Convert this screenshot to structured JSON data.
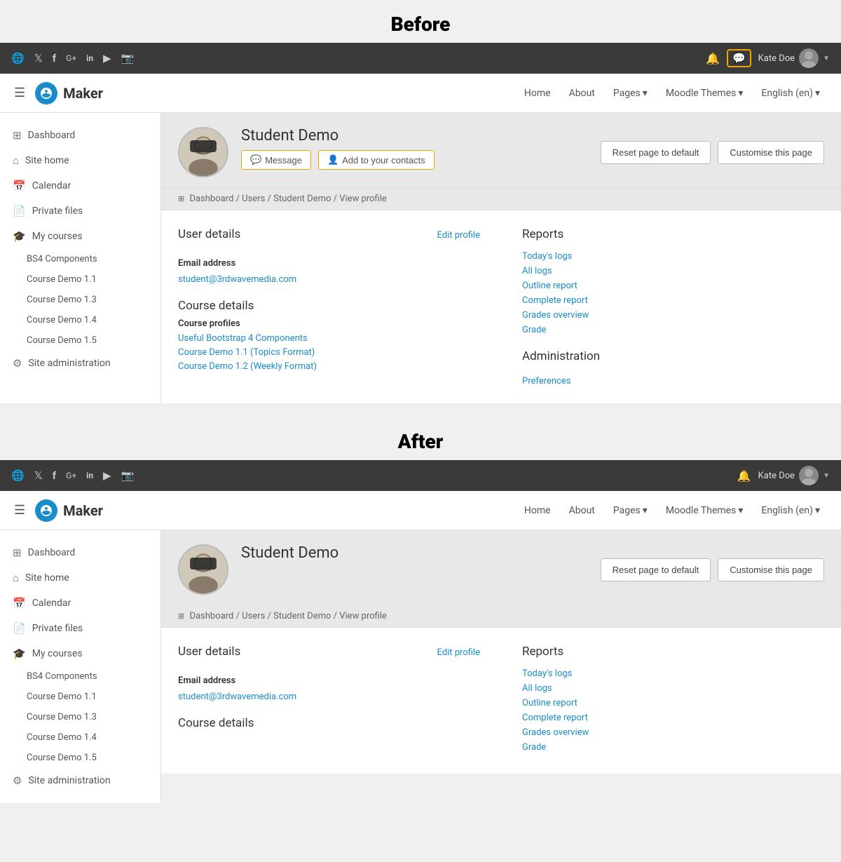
{
  "before_label": "Before",
  "after_label": "After",
  "topbar": {
    "icons": [
      "🌐",
      "🐦",
      "f",
      "G+",
      "in",
      "▶",
      "📷"
    ],
    "bell": "🔔",
    "username": "Kate Doe",
    "message_icon": "💬",
    "caret": "▼"
  },
  "navbar": {
    "logo_text": "Maker",
    "home": "Home",
    "about": "About",
    "pages": "Pages",
    "moodle_themes": "Moodle Themes",
    "english": "English (en)"
  },
  "sidebar": {
    "dashboard": "Dashboard",
    "site_home": "Site home",
    "calendar": "Calendar",
    "private_files": "Private files",
    "my_courses": "My courses",
    "courses": [
      "BS4 Components",
      "Course Demo 1.1",
      "Course Demo 1.3",
      "Course Demo 1.4",
      "Course Demo 1.5"
    ],
    "site_admin": "Site administration"
  },
  "profile": {
    "name": "Student Demo",
    "message_btn": "Message",
    "contacts_btn": "Add to your contacts",
    "reset_btn": "Reset page to default",
    "customise_btn": "Customise this page"
  },
  "breadcrumb": {
    "dashboard": "Dashboard",
    "users": "Users",
    "student_demo": "Student Demo",
    "view_profile": "View profile"
  },
  "user_details": {
    "title": "User details",
    "edit_profile": "Edit profile",
    "email_label": "Email address",
    "email_value": "student@3rdwavemedia.com"
  },
  "reports": {
    "title": "Reports",
    "todays_logs": "Today's logs",
    "all_logs": "All logs",
    "outline_report": "Outline report",
    "complete_report": "Complete report",
    "grades_overview": "Grades overview",
    "grade": "Grade"
  },
  "course_details": {
    "title": "Course details",
    "profiles_label": "Course profiles",
    "links": [
      "Useful Bootstrap 4 Components",
      "Course Demo 1.1 (Topics Format)",
      "Course Demo 1.2 (Weekly Format)"
    ]
  },
  "administration": {
    "title": "Administration",
    "preferences": "Preferences"
  }
}
